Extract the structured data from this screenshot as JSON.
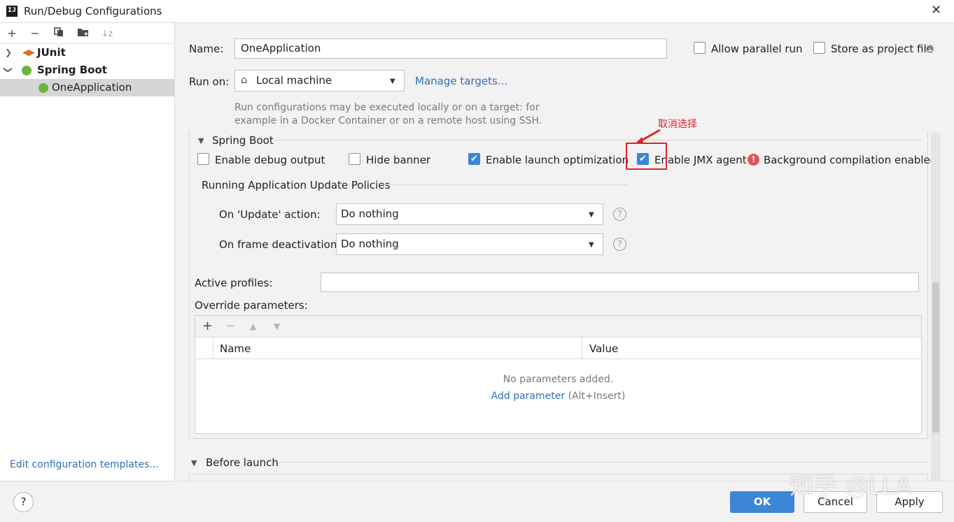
{
  "window": {
    "title": "Run/Debug Configurations",
    "app_icon_glyph": "IJ"
  },
  "left": {
    "toolbar_icons": [
      "add-icon",
      "remove-icon",
      "copy-icon",
      "new-folder-icon",
      "sort-icon"
    ],
    "tree": [
      {
        "label": "JUnit",
        "expanded": false
      },
      {
        "label": "Spring Boot",
        "expanded": true
      },
      {
        "label": "OneApplication",
        "selected": true
      }
    ],
    "edit_templates_link": "Edit configuration templates..."
  },
  "form": {
    "name_label": "Name:",
    "name_value": "OneApplication",
    "allow_parallel_label": "Allow parallel run",
    "store_project_label": "Store as project file",
    "run_on_label": "Run on:",
    "run_on_value": "Local machine",
    "manage_targets_link": "Manage targets...",
    "run_on_hint_line1": "Run configurations may be executed locally or on a target: for",
    "run_on_hint_line2": "example in a Docker Container or on a remote host using SSH."
  },
  "spring_boot": {
    "section_title": "Spring Boot",
    "checkboxes": [
      {
        "label": "Enable debug output",
        "checked": false
      },
      {
        "label": "Hide banner",
        "checked": false
      },
      {
        "label": "Enable launch optimization",
        "checked": true
      },
      {
        "label": "Enable JMX agent",
        "checked": true
      }
    ],
    "background_compilation_label": "Background compilation enabled",
    "annotation_text": "取消选择",
    "update_policies_title": "Running Application Update Policies",
    "on_update_label": "On 'Update' action:",
    "on_update_value": "Do nothing",
    "on_frame_label": "On frame deactivation:",
    "on_frame_value": "Do nothing",
    "active_profiles_label": "Active profiles:",
    "active_profiles_value": "",
    "override_params_label": "Override parameters:",
    "table": {
      "columns": [
        "Name",
        "Value"
      ],
      "empty_text": "No parameters added.",
      "add_link": "Add parameter",
      "add_shortcut": "(Alt+Insert)"
    }
  },
  "before_launch": {
    "title": "Before launch"
  },
  "buttons": {
    "help": "?",
    "ok": "OK",
    "cancel": "Cancel",
    "apply": "Apply"
  },
  "watermark": "知乎 @LLA",
  "colors": {
    "accent": "#3d85d6",
    "link": "#2f6fb5",
    "annotation_red": "#e0242b",
    "error_red": "#e05555"
  }
}
